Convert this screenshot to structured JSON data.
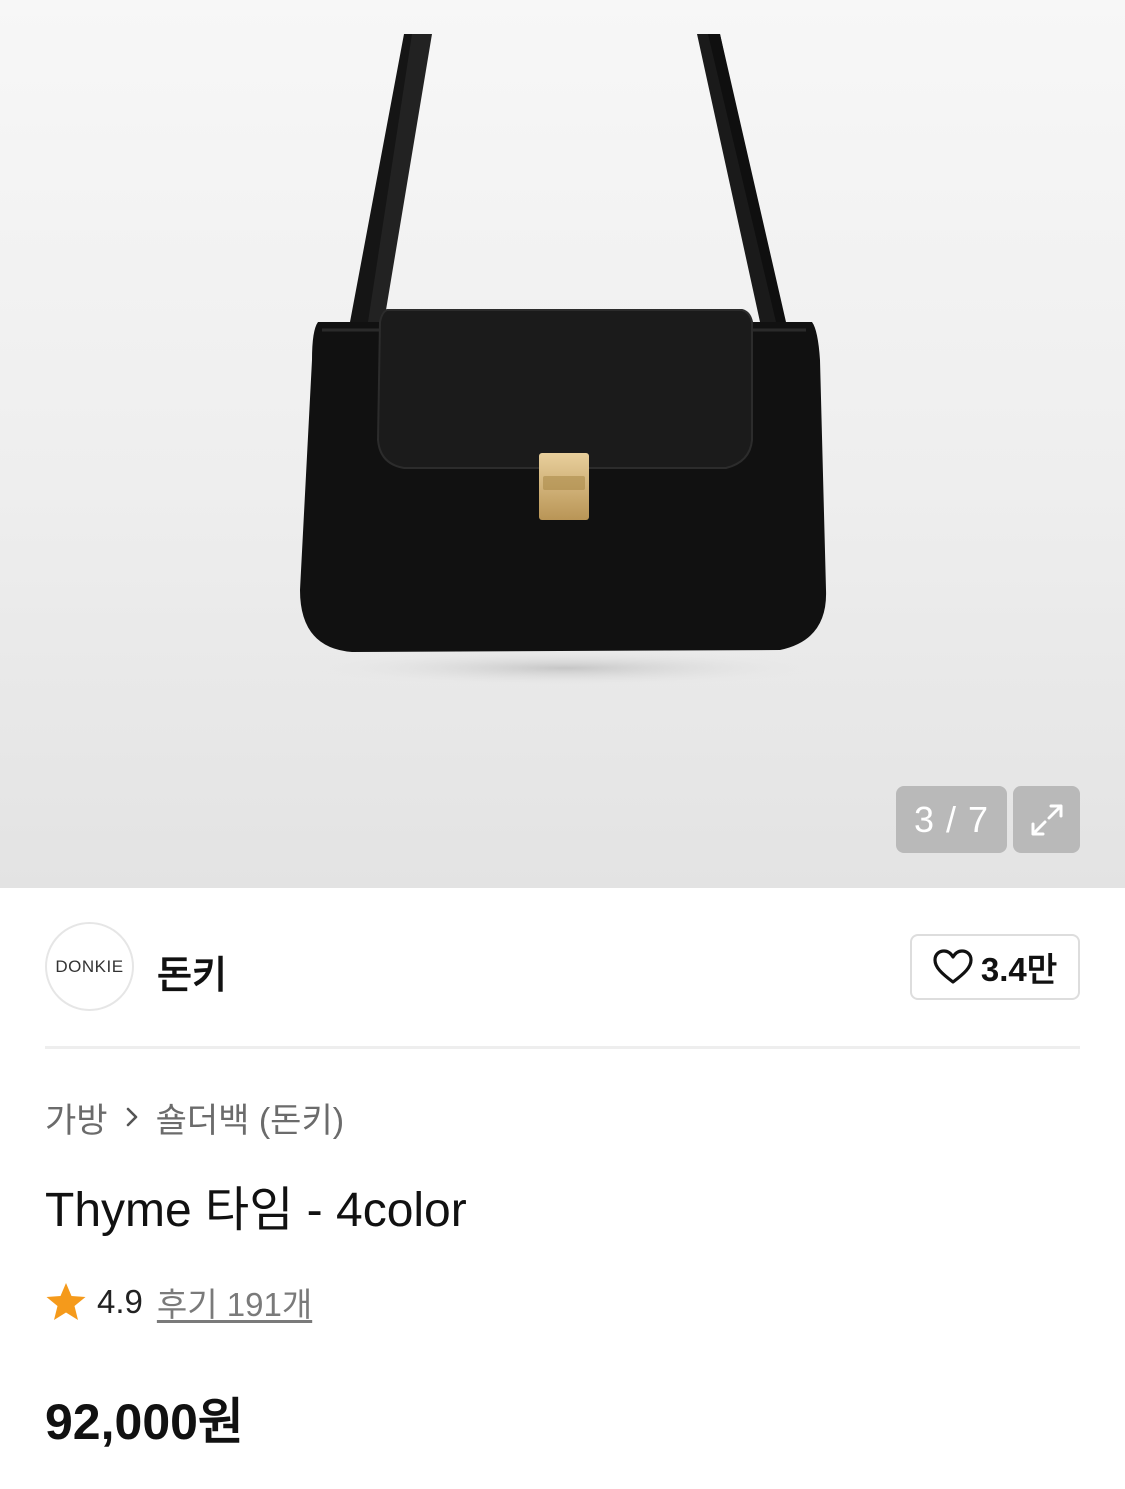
{
  "gallery": {
    "image_alt": "Black leather shoulder bag with gold clasp",
    "counter": "3 / 7",
    "expand_icon": "expand-icon"
  },
  "brand": {
    "logo_text": "DONKIE",
    "name": "돈키"
  },
  "like": {
    "icon": "heart-icon",
    "count": "3.4만"
  },
  "breadcrumb": {
    "items": [
      "가방",
      "숄더백 (돈키)"
    ],
    "separator_icon": "chevron-right-icon"
  },
  "product": {
    "title": "Thyme 타임 - 4color",
    "rating": "4.9",
    "review_link": "후기 191개",
    "price": "92,000원"
  },
  "colors": {
    "star": "#f59a1b",
    "overlay": "#b9b9b9",
    "muted_text": "#6b6b6b"
  }
}
